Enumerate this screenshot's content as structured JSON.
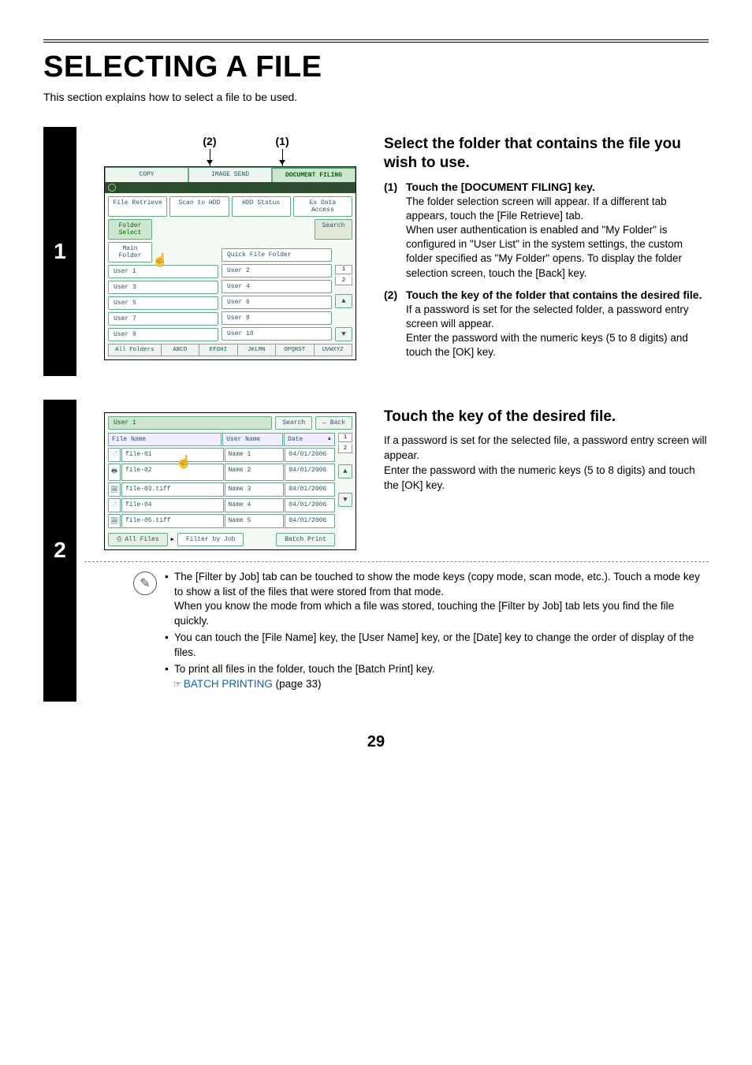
{
  "page": {
    "title": "SELECTING A FILE",
    "intro": "This section explains how to select a file to be used.",
    "number": "29"
  },
  "step1": {
    "num": "1",
    "callout1": "(2)",
    "callout2": "(1)",
    "heading": "Select the folder that contains the file you wish to use.",
    "sub1": {
      "num": "(1)",
      "title": "Touch the [DOCUMENT FILING] key.",
      "body": "The folder selection screen will appear. If a different tab appears, touch the [File Retrieve] tab.\nWhen user authentication is enabled and \"My Folder\" is configured in \"User List\" in the system settings, the custom folder specified as \"My Folder\" opens. To display the folder selection screen, touch the [Back] key."
    },
    "sub2": {
      "num": "(2)",
      "title": "Touch the key of the folder that contains the desired file.",
      "body": "If a password is set for the selected folder, a password entry screen will appear.\nEnter the password with the numeric keys (5 to 8 digits) and touch the [OK] key."
    },
    "scr": {
      "tabs": {
        "copy": "COPY",
        "image_send": "IMAGE SEND",
        "doc_filing": "DOCUMENT FILING"
      },
      "side_tabs": {
        "file_retrieve": "File Retrieve",
        "scan_to_hdd": "Scan to HDD",
        "hdd_status": "HDD Status",
        "ex_data": "Ex Data Access"
      },
      "folder_select": "Folder Select",
      "search": "Search",
      "main_folder": "Main Folder",
      "quick_folder": "Quick File Folder",
      "users": [
        "User 1",
        "User 2",
        "User 3",
        "User 4",
        "User 5",
        "User 6",
        "User 7",
        "User 8",
        "User 9",
        "User 10"
      ],
      "page_top": "1",
      "page_bot": "2",
      "alpha": [
        "All Folders",
        "ABCD",
        "EFGHI",
        "JKLMN",
        "OPQRST",
        "UVWXYZ"
      ]
    }
  },
  "step2": {
    "num": "2",
    "heading": "Touch the key of the desired file.",
    "desc": "If a password is set for the selected file, a password entry screen will appear.\nEnter the password with the numeric keys (5 to 8 digits) and touch the [OK] key.",
    "scr": {
      "title": "User 1",
      "search": "Search",
      "back": "Back",
      "hdr_file": "File Name",
      "hdr_user": "User Name",
      "hdr_date": "Date",
      "rows": [
        {
          "name": "file-01",
          "user": "Name 1",
          "date": "04/01/2006"
        },
        {
          "name": "file-02",
          "user": "Name 2",
          "date": "04/01/2006"
        },
        {
          "name": "file-03.tiff",
          "user": "Name 3",
          "date": "04/01/2006"
        },
        {
          "name": "file-04",
          "user": "Name 4",
          "date": "04/01/2006"
        },
        {
          "name": "file-05.tiff",
          "user": "Name 5",
          "date": "04/01/2006"
        }
      ],
      "page_top": "1",
      "page_bot": "2",
      "all_files": "All Files",
      "filter": "Filter by Job",
      "batch": "Batch Print"
    },
    "notes": {
      "n1": "The [Filter by Job] tab can be touched to show the mode keys (copy mode, scan mode, etc.). Touch a mode key to show a list of the files that were stored from that mode.",
      "n1b": "When you know the mode from which a file was stored, touching the [Filter by Job] tab lets you find the file quickly.",
      "n2": "You can touch the [File Name] key, the [User Name] key, or the [Date] key to change the order of display of the files.",
      "n3": "To print all files in the folder, touch the [Batch Print] key.",
      "xref_icon": "☞",
      "xref_text": "BATCH PRINTING",
      "xref_page": " (page 33)"
    }
  }
}
